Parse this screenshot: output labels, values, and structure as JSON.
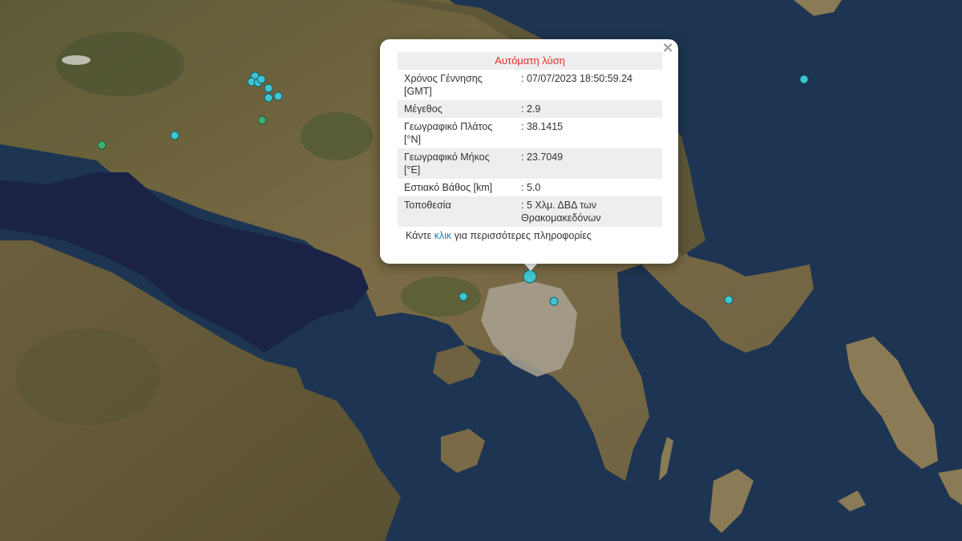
{
  "map": {
    "colors": {
      "sea": "#1d3552",
      "gulf": "#1a2246",
      "land": "#7a6a45",
      "forest": "#4d5a30",
      "urban": "#a9a292",
      "quake_marker": "#3fc5d2",
      "quake_marker_old": "#3fae6e"
    },
    "markers": [
      "recent-quake",
      "older-quake",
      "selected-quake"
    ]
  },
  "popup": {
    "title": "Αυτόματη λύση",
    "rows": [
      {
        "label": "Χρόνος Γέννησης [GMT]",
        "value": ": 07/07/2023 18:50:59.24"
      },
      {
        "label": "Μέγεθος",
        "value": ": 2.9"
      },
      {
        "label": "Γεωγραφικό Πλάτος [°N]",
        "value": ": 38.1415"
      },
      {
        "label": "Γεωγραφικό Μήκος [°E]",
        "value": ": 23.7049"
      },
      {
        "label": "Εστιακό Βάθος [km]",
        "value": ": 5.0"
      },
      {
        "label": "Τοποθεσία",
        "value": ": 5 Χλμ. ΔΒΔ των Θρακομακεδόνων"
      }
    ],
    "more_prefix": "Κάντε",
    "more_link": "κλικ",
    "more_suffix": "για περισσότερες πληροφορίες",
    "close_symbol": "×"
  }
}
